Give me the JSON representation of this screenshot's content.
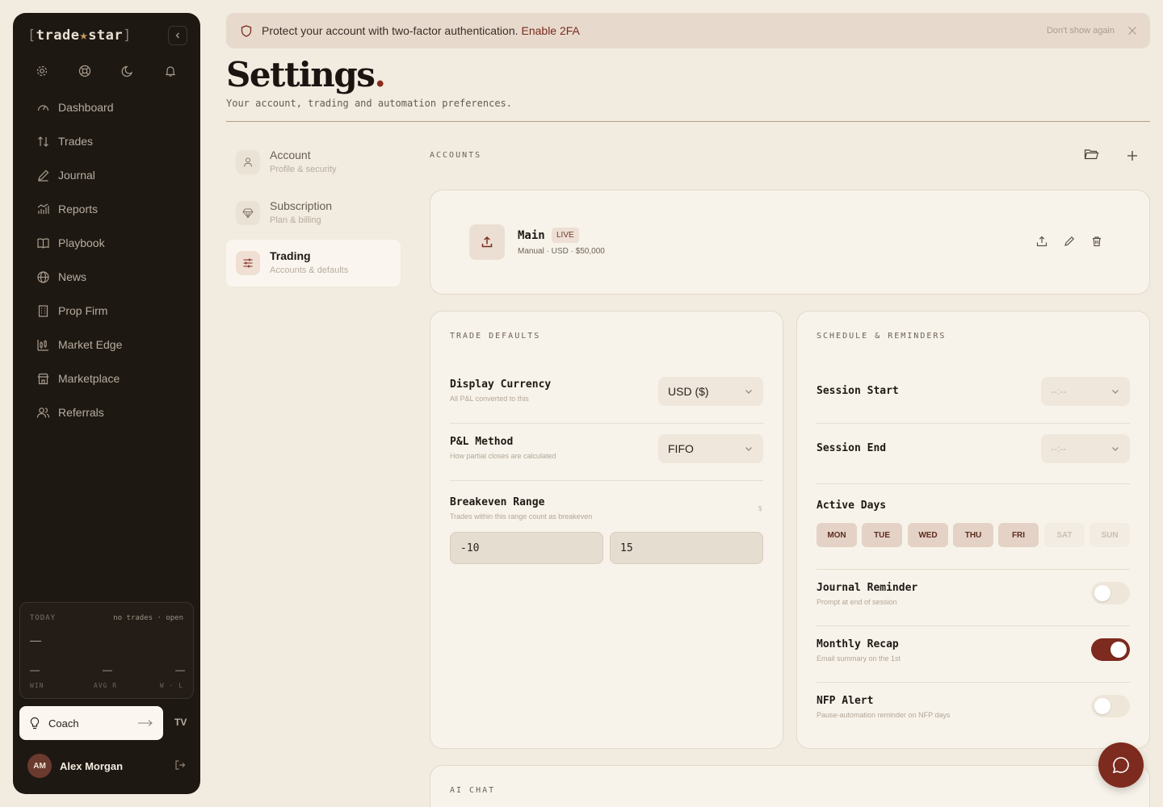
{
  "sidebar": {
    "logo": {
      "bracket_open": "[",
      "part1": "trade",
      "star": "★",
      "part2": "star",
      "bracket_close": "]"
    },
    "items": [
      {
        "label": "Dashboard",
        "icon": "gauge-icon"
      },
      {
        "label": "Trades",
        "icon": "arrows-up-down-icon"
      },
      {
        "label": "Journal",
        "icon": "pen-icon"
      },
      {
        "label": "Reports",
        "icon": "bar-chart-icon"
      },
      {
        "label": "Playbook",
        "icon": "book-icon"
      },
      {
        "label": "News",
        "icon": "globe-icon"
      },
      {
        "label": "Prop Firm",
        "icon": "building-icon"
      },
      {
        "label": "Market Edge",
        "icon": "candlestick-icon"
      },
      {
        "label": "Marketplace",
        "icon": "store-icon"
      },
      {
        "label": "Referrals",
        "icon": "users-icon"
      }
    ],
    "today": {
      "label": "TODAY",
      "status": "no trades · open",
      "value": "—",
      "win": "—",
      "avg_r": "—",
      "wl": "—",
      "win_label": "WIN",
      "avg_r_label": "AVG R",
      "wl_label": "W · L"
    },
    "coach_label": "Coach",
    "tv_label": "TV",
    "user": {
      "initials": "AM",
      "name": "Alex Morgan"
    }
  },
  "banner": {
    "text": "Protect your account with two-factor authentication.",
    "link": "Enable 2FA",
    "dismiss": "Don't show again"
  },
  "header": {
    "title": "Settings",
    "title_dot": ".",
    "subtitle": "Your account, trading and automation preferences."
  },
  "settings_nav": [
    {
      "title": "Account",
      "sub": "Profile & security"
    },
    {
      "title": "Subscription",
      "sub": "Plan & billing"
    },
    {
      "title": "Trading",
      "sub": "Accounts & defaults"
    }
  ],
  "accounts": {
    "label": "ACCOUNTS",
    "items": [
      {
        "name": "Main",
        "badge": "LIVE",
        "meta": "Manual · USD · $50,000"
      }
    ]
  },
  "trade_defaults": {
    "label": "TRADE DEFAULTS",
    "currency": {
      "title": "Display Currency",
      "sub": "All P&L converted to this",
      "value": "USD ($)"
    },
    "pnl": {
      "title": "P&L Method",
      "sub": "How partial closes are calculated",
      "value": "FIFO"
    },
    "breakeven": {
      "title": "Breakeven Range",
      "sub": "Trades within this range count as breakeven",
      "unit": "$",
      "min": "-10",
      "max": "15"
    }
  },
  "schedule": {
    "label": "SCHEDULE & REMINDERS",
    "session_start": {
      "title": "Session Start",
      "value": "--:--"
    },
    "session_end": {
      "title": "Session End",
      "value": "--:--"
    },
    "active_days": {
      "title": "Active Days",
      "days": [
        {
          "label": "MON",
          "on": true
        },
        {
          "label": "TUE",
          "on": true
        },
        {
          "label": "WED",
          "on": true
        },
        {
          "label": "THU",
          "on": true
        },
        {
          "label": "FRI",
          "on": true
        },
        {
          "label": "SAT",
          "on": false
        },
        {
          "label": "SUN",
          "on": false
        }
      ]
    },
    "journal_reminder": {
      "title": "Journal Reminder",
      "sub": "Prompt at end of session",
      "on": false
    },
    "monthly_recap": {
      "title": "Monthly Recap",
      "sub": "Email summary on the 1st",
      "on": true
    },
    "nfp_alert": {
      "title": "NFP Alert",
      "sub": "Pause-automation reminder on NFP days",
      "on": false
    }
  },
  "ai_chat": {
    "label": "AI CHAT"
  },
  "colors": {
    "accent": "#7d2a1f",
    "sidebar_bg": "#1e1813",
    "page_bg": "#f1ebe0"
  }
}
